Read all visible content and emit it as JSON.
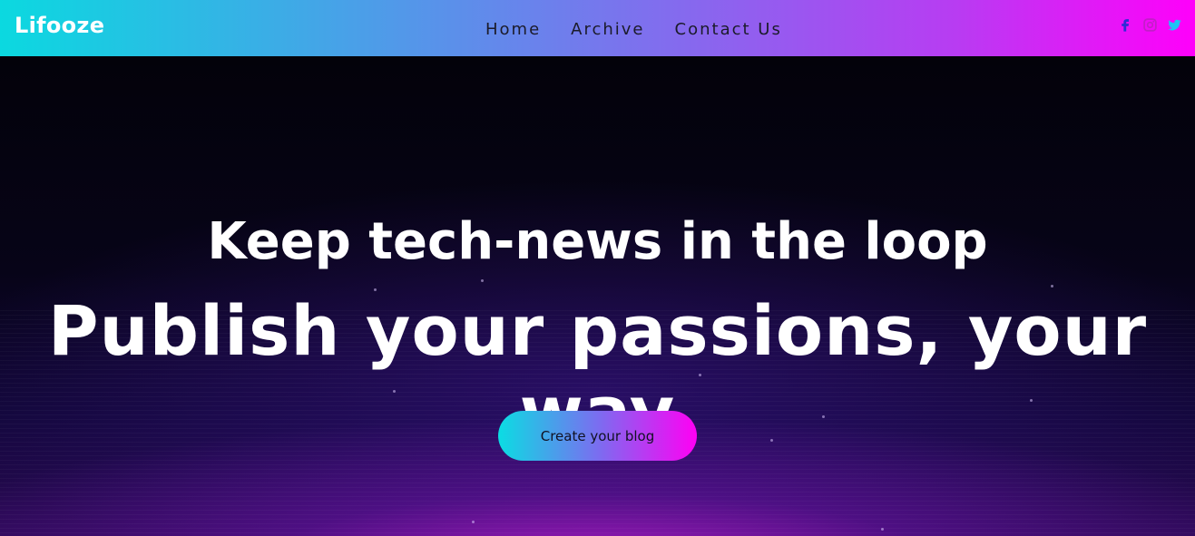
{
  "navbar": {
    "brand": "Lifooze",
    "links": [
      {
        "label": "Home"
      },
      {
        "label": "Archive"
      },
      {
        "label": "Contact Us"
      }
    ],
    "socials": [
      {
        "icon": "facebook-icon",
        "color": "#2e2bd6"
      },
      {
        "icon": "instagram-icon",
        "color": "#c21ec8"
      },
      {
        "icon": "twitter-icon",
        "color": "#1dc4f5"
      }
    ]
  },
  "hero": {
    "tagline": "Keep tech-news in the loop",
    "headline": "Publish your passions, your way",
    "cta_label": "Create your blog"
  },
  "colors": {
    "nav_gradient_start": "#0bd9e0",
    "nav_gradient_end": "#ff00fa",
    "hero_background": "#04020c",
    "hero_glow": "#c81edc"
  }
}
